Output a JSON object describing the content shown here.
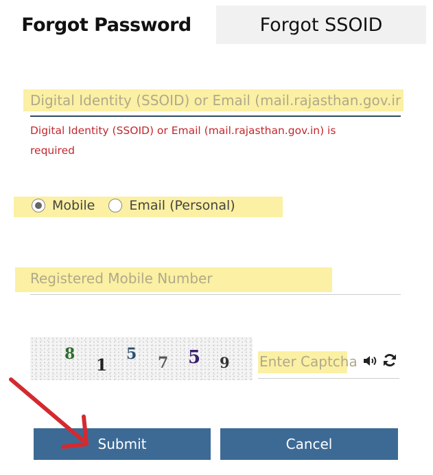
{
  "tabs": {
    "forgot_password": "Forgot Password",
    "forgot_ssoid": "Forgot SSOID"
  },
  "form": {
    "identity_placeholder": "Digital Identity (SSOID) or Email (mail.rajasthan.gov.in)",
    "identity_error": "Digital Identity (SSOID) or Email (mail.rajasthan.gov.in) is required",
    "radio_mobile": "Mobile",
    "radio_email": "Email (Personal)",
    "selected_option": "Mobile",
    "mobile_placeholder": "Registered Mobile Number",
    "captcha_digits": [
      "8",
      "1",
      "5",
      "7",
      "5",
      "9"
    ],
    "captcha_placeholder": "Enter Captcha",
    "speaker_icon": "speaker-icon",
    "refresh_icon": "refresh-icon"
  },
  "buttons": {
    "submit": "Submit",
    "cancel": "Cancel"
  },
  "colors": {
    "primary_button": "#3d6a95",
    "error_text": "#c1272d",
    "highlight": "#fbf0a3",
    "annotation_arrow": "#d42a2f"
  }
}
